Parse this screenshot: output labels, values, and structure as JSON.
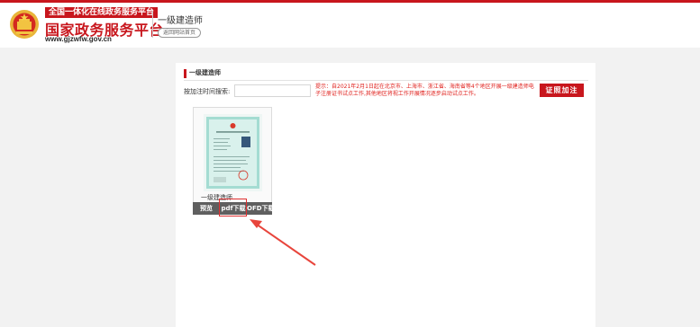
{
  "header": {
    "brand_top": "全国一体化在线政务服务平台",
    "brand_main": "国家政务服务平台",
    "brand_url": "www.gjzwfw.gov.cn",
    "page_title": "一级建造师",
    "back_button": "返回网站首页"
  },
  "section": {
    "title": "一级建造师"
  },
  "search": {
    "label": "按加注时间搜索:",
    "value": "",
    "placeholder": ""
  },
  "notice": "提示：自2021年2月1日起在北京市、上海市、浙江省、海南省等4个地区开展一级建造师电子注册证书试点工作,其他地区将视工作开展情况逐步启动试点工作。",
  "follow_button": "证照加注",
  "certificate_card": {
    "name": "一级建造师",
    "actions": {
      "preview": "预览",
      "pdf": "pdf下载",
      "ofd": "OFD下载"
    }
  },
  "colors": {
    "brand_red": "#c8161d",
    "notice_red": "#e0201c",
    "highlight_red": "#e03030",
    "cert_green": "#9fd9cf"
  },
  "icons": {
    "emblem": "national-emblem-icon",
    "certificate": "certificate-thumbnail",
    "arrow": "annotation-arrow"
  }
}
